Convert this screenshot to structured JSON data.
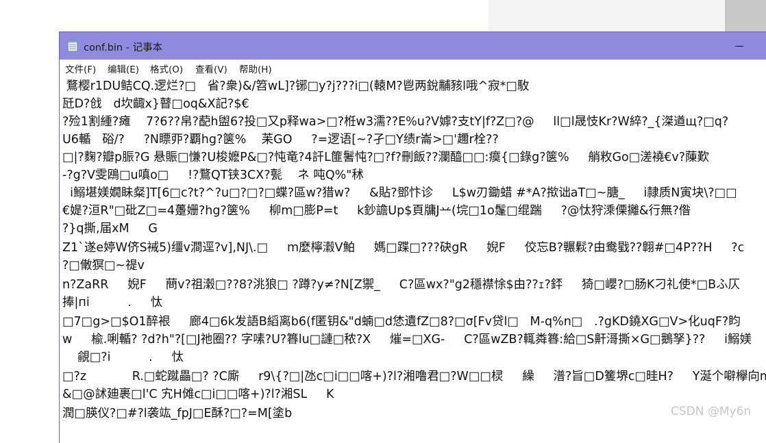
{
  "window": {
    "title": "conf.bin - 记事本"
  },
  "menu": {
    "items": [
      "文件(F)",
      "编辑(E)",
      "格式(O)",
      "查看(V)",
      "帮助(H)"
    ]
  },
  "editor": {
    "lines": [
      " 鶩樱r1DU鲒CQ.逻烂?□   省?衆)&/笤wL]?铘□y?j???i□(轅M?鬯两銳黼豥l哦^寂*□駇",
      "瓩D?戗   d坎齱x}瞽□oq&X記?$€",
      "?殓1割緟?瘫    7?6??帛?蓜h盥6?投□又p释wa>□?栣w3濡??E%u?V嫭?支tY|f?Z□?@     ll□l晟忮Kr?W綷?_{滐遒щ?□q?",
      "U6輴   硲/?     ?N瞟丣?覇hg?箧%    苿GO     ?=逻语[~?孑□Y绩r崙>□'趰r栓??",
      "□|?麴?瓣p脤?G 悬賑□慊?U梭嬷P&□?忳竜?4訐L篚鬐忳?□?f?刪飯??瀾醯□□:瘼{□錄g?箧%     艄敉Go□溠襓€v?蔯歎",
      "-?g?V雯鴎□u嗔o□     !?鶩QT铗3CX?甏    ネ 吨Q%\"秫",
      "  i鰯堪媄嫺眛粲]T[6□c?t?^?u□?□?□蝶?區w?猎w?     &貼?鄧忭诊     L$w刃鋤蜡 #*A?揿诎aT□~膅_     i隷质N寅块\\?□□",
      "€媞?洹R\"□砒Z□=4躉姗?hg?箧%     柳m□膨P=t     k鈔譫Up$頁牗J䒑(垸□1o鬔□绲踹     ?@忲狩溗傈攡&行無?偺",
      "?}q撕,届xM     G",
      "Z1`遂e婷W侪S裓5)缰v澗逕?v],NJ\\.□     m麼檸瀫V鮊     媽□蹀□???砄gR     婗F     佼忘B?冁鬏?由鸯戥??翺#□4P??H     ?c",
      "?□僌猽□~禔v",
      "n?ZaRR     婗F     蔄v?祖濲□??8?洮狼□ ?蹲?y≠?N[Z禦_     C?區wx?\"g2穩襟悇$由??ｪ?銔     猗□巊?□肠K刁礼使*□Bふ仄",
      "捧|пі          .     忲",
      "□7□g>□$O1醉裉     廊4□6k发語B縚离b6(f匿钥&\"d蝻□d恷遺fZ□8?□σ[Fv贷l□   M-q%n□   .?gKD鐃XG□V>化uqF?盷",
      "w     楡.唎輴? ?d?h\"?[□J祂圈?? 字嗉?U?簭lu□謰□秾?X     熣=□XG-     C?區wZB?輒粦簭:給□S鼾滒撕×G□鵝孥}??     i鰯媄",
      "    覦□?i          .     忲",
      "□?z            R.□蛇蹴畾□? ?C廝     r9\\{?□|氹c□i□□喀+)?l?湘噜君□?W□□棂     繰     潽?旨□D籆堺c□晆H?     Y涎个噼欅向m",
      "&□@訹廸裹□l'C 宄H傩c□i□□喀+)?l?湘SL     K",
      "潤□朠仪?□#?l袭竑_fpJ□E酥?□?=M[塗b"
    ]
  },
  "watermark": {
    "text": "CSDN @My6n"
  }
}
